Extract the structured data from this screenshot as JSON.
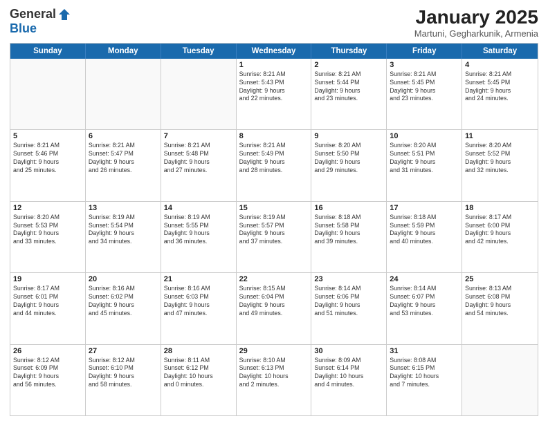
{
  "logo": {
    "general": "General",
    "blue": "Blue"
  },
  "title": "January 2025",
  "location": "Martuni, Gegharkunik, Armenia",
  "days": [
    "Sunday",
    "Monday",
    "Tuesday",
    "Wednesday",
    "Thursday",
    "Friday",
    "Saturday"
  ],
  "weeks": [
    [
      {
        "day": "",
        "info": ""
      },
      {
        "day": "",
        "info": ""
      },
      {
        "day": "",
        "info": ""
      },
      {
        "day": "1",
        "info": "Sunrise: 8:21 AM\nSunset: 5:43 PM\nDaylight: 9 hours\nand 22 minutes."
      },
      {
        "day": "2",
        "info": "Sunrise: 8:21 AM\nSunset: 5:44 PM\nDaylight: 9 hours\nand 23 minutes."
      },
      {
        "day": "3",
        "info": "Sunrise: 8:21 AM\nSunset: 5:45 PM\nDaylight: 9 hours\nand 23 minutes."
      },
      {
        "day": "4",
        "info": "Sunrise: 8:21 AM\nSunset: 5:45 PM\nDaylight: 9 hours\nand 24 minutes."
      }
    ],
    [
      {
        "day": "5",
        "info": "Sunrise: 8:21 AM\nSunset: 5:46 PM\nDaylight: 9 hours\nand 25 minutes."
      },
      {
        "day": "6",
        "info": "Sunrise: 8:21 AM\nSunset: 5:47 PM\nDaylight: 9 hours\nand 26 minutes."
      },
      {
        "day": "7",
        "info": "Sunrise: 8:21 AM\nSunset: 5:48 PM\nDaylight: 9 hours\nand 27 minutes."
      },
      {
        "day": "8",
        "info": "Sunrise: 8:21 AM\nSunset: 5:49 PM\nDaylight: 9 hours\nand 28 minutes."
      },
      {
        "day": "9",
        "info": "Sunrise: 8:20 AM\nSunset: 5:50 PM\nDaylight: 9 hours\nand 29 minutes."
      },
      {
        "day": "10",
        "info": "Sunrise: 8:20 AM\nSunset: 5:51 PM\nDaylight: 9 hours\nand 31 minutes."
      },
      {
        "day": "11",
        "info": "Sunrise: 8:20 AM\nSunset: 5:52 PM\nDaylight: 9 hours\nand 32 minutes."
      }
    ],
    [
      {
        "day": "12",
        "info": "Sunrise: 8:20 AM\nSunset: 5:53 PM\nDaylight: 9 hours\nand 33 minutes."
      },
      {
        "day": "13",
        "info": "Sunrise: 8:19 AM\nSunset: 5:54 PM\nDaylight: 9 hours\nand 34 minutes."
      },
      {
        "day": "14",
        "info": "Sunrise: 8:19 AM\nSunset: 5:55 PM\nDaylight: 9 hours\nand 36 minutes."
      },
      {
        "day": "15",
        "info": "Sunrise: 8:19 AM\nSunset: 5:57 PM\nDaylight: 9 hours\nand 37 minutes."
      },
      {
        "day": "16",
        "info": "Sunrise: 8:18 AM\nSunset: 5:58 PM\nDaylight: 9 hours\nand 39 minutes."
      },
      {
        "day": "17",
        "info": "Sunrise: 8:18 AM\nSunset: 5:59 PM\nDaylight: 9 hours\nand 40 minutes."
      },
      {
        "day": "18",
        "info": "Sunrise: 8:17 AM\nSunset: 6:00 PM\nDaylight: 9 hours\nand 42 minutes."
      }
    ],
    [
      {
        "day": "19",
        "info": "Sunrise: 8:17 AM\nSunset: 6:01 PM\nDaylight: 9 hours\nand 44 minutes."
      },
      {
        "day": "20",
        "info": "Sunrise: 8:16 AM\nSunset: 6:02 PM\nDaylight: 9 hours\nand 45 minutes."
      },
      {
        "day": "21",
        "info": "Sunrise: 8:16 AM\nSunset: 6:03 PM\nDaylight: 9 hours\nand 47 minutes."
      },
      {
        "day": "22",
        "info": "Sunrise: 8:15 AM\nSunset: 6:04 PM\nDaylight: 9 hours\nand 49 minutes."
      },
      {
        "day": "23",
        "info": "Sunrise: 8:14 AM\nSunset: 6:06 PM\nDaylight: 9 hours\nand 51 minutes."
      },
      {
        "day": "24",
        "info": "Sunrise: 8:14 AM\nSunset: 6:07 PM\nDaylight: 9 hours\nand 53 minutes."
      },
      {
        "day": "25",
        "info": "Sunrise: 8:13 AM\nSunset: 6:08 PM\nDaylight: 9 hours\nand 54 minutes."
      }
    ],
    [
      {
        "day": "26",
        "info": "Sunrise: 8:12 AM\nSunset: 6:09 PM\nDaylight: 9 hours\nand 56 minutes."
      },
      {
        "day": "27",
        "info": "Sunrise: 8:12 AM\nSunset: 6:10 PM\nDaylight: 9 hours\nand 58 minutes."
      },
      {
        "day": "28",
        "info": "Sunrise: 8:11 AM\nSunset: 6:12 PM\nDaylight: 10 hours\nand 0 minutes."
      },
      {
        "day": "29",
        "info": "Sunrise: 8:10 AM\nSunset: 6:13 PM\nDaylight: 10 hours\nand 2 minutes."
      },
      {
        "day": "30",
        "info": "Sunrise: 8:09 AM\nSunset: 6:14 PM\nDaylight: 10 hours\nand 4 minutes."
      },
      {
        "day": "31",
        "info": "Sunrise: 8:08 AM\nSunset: 6:15 PM\nDaylight: 10 hours\nand 7 minutes."
      },
      {
        "day": "",
        "info": ""
      }
    ]
  ]
}
